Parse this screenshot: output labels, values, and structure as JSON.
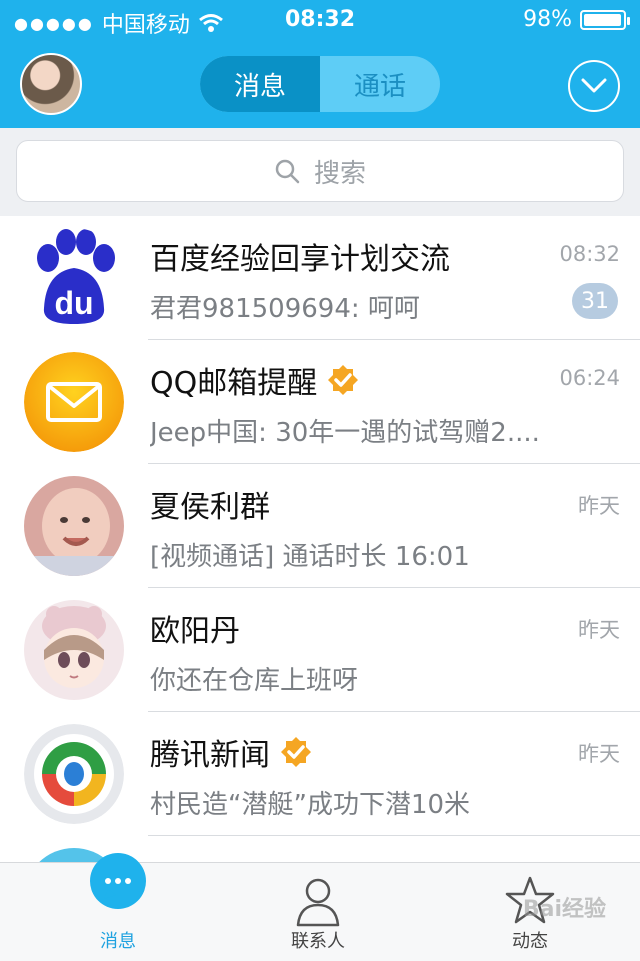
{
  "status_bar": {
    "signal": "●●●●●",
    "carrier": "中国移动",
    "time": "08:32",
    "battery": "98%",
    "battery_level": 0.98
  },
  "header": {
    "tabs": [
      {
        "label": "消息",
        "active": true
      },
      {
        "label": "通话",
        "active": false
      }
    ]
  },
  "search": {
    "placeholder": "搜索"
  },
  "conversations": [
    {
      "name": "百度经验回享计划交流",
      "time": "08:32",
      "preview": "君君981509694: 呵呵",
      "badge": "31",
      "verified": false,
      "avatar": "baidu-logo"
    },
    {
      "name": "QQ邮箱提醒",
      "time": "06:24",
      "preview": "Jeep中国: 30年一遇的试驾赠2....",
      "badge": "",
      "verified": true,
      "avatar": "mail-icon"
    },
    {
      "name": "夏侯利群",
      "time": "昨天",
      "preview": "[视频通话] 通话时长 16:01",
      "badge": "",
      "verified": false,
      "avatar": "baby-photo"
    },
    {
      "name": "欧阳丹",
      "time": "昨天",
      "preview": "你还在仓库上班呀",
      "badge": "",
      "verified": false,
      "avatar": "anime-avatar"
    },
    {
      "name": "腾讯新闻",
      "time": "昨天",
      "preview": "村民造“潜艇”成功下潜10米",
      "badge": "",
      "verified": true,
      "avatar": "tencent-news-logo"
    }
  ],
  "tabbar": {
    "items": [
      {
        "label": "消息",
        "icon": "chat-bubble-icon",
        "active": true
      },
      {
        "label": "联系人",
        "icon": "person-icon",
        "active": false
      },
      {
        "label": "动态",
        "icon": "star-icon",
        "active": false
      }
    ],
    "watermark": "Bai经验"
  },
  "colors": {
    "header_bg": "#1fb2ec",
    "active_tab": "#0a91c6",
    "badge": "#b6cbe0",
    "verified": "#f5a623"
  }
}
